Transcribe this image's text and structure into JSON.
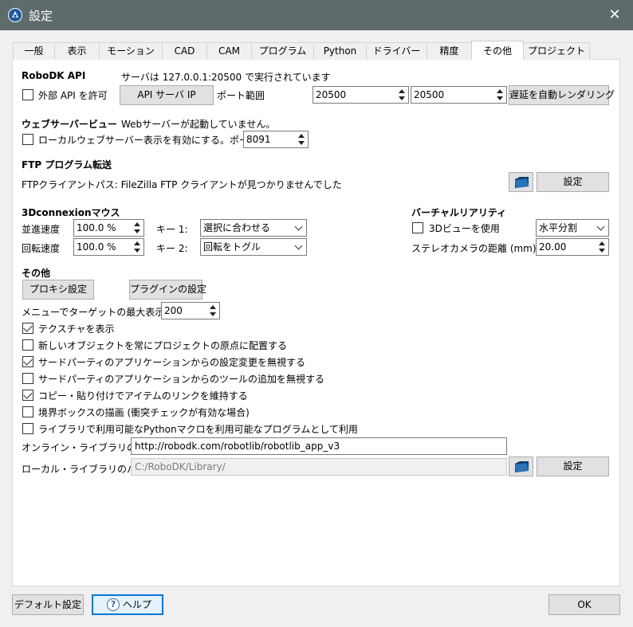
{
  "window": {
    "title": "設定",
    "close_glyph": "✕"
  },
  "tabs": [
    {
      "label": "一般"
    },
    {
      "label": "表示"
    },
    {
      "label": "モーション"
    },
    {
      "label": "CAD"
    },
    {
      "label": "CAM"
    },
    {
      "label": "プログラム"
    },
    {
      "label": "Python"
    },
    {
      "label": "ドライバー"
    },
    {
      "label": "精度"
    },
    {
      "label": "その他",
      "active": true
    },
    {
      "label": "プロジェクト"
    }
  ],
  "robodk_api": {
    "title": "RoboDK API",
    "status": "サーバは 127.0.0.1:20500 で実行されています",
    "allow_external_label": "外部 API を許可",
    "allow_external_checked": false,
    "api_server_ip_button": "API サーバ IP",
    "port_range_label": "ポート範囲",
    "port_from": "20500",
    "port_to": "20500",
    "auto_render_delay_button": "遅延を自動レンダリング"
  },
  "web_server": {
    "title": "ウェブサーバービュー",
    "status": "Webサーバーが起動していません。",
    "enable_label": "ローカルウェブサーバー表示を有効にする。ポート:",
    "enable_checked": false,
    "port": "8091"
  },
  "ftp": {
    "title": "FTP プログラム転送",
    "client_path": "FTPクライアントパス: FileZilla FTP クライアントが見つかりませんでした",
    "settings_button": "設定"
  },
  "connexion": {
    "title": "3Dconnexionマウス",
    "translation_speed_label": "並進速度",
    "translation_speed": "100.0 %",
    "rotation_speed_label": "回転速度",
    "rotation_speed": "100.0 %",
    "key1_label": "キー 1:",
    "key1_value": "選択に合わせる",
    "key2_label": "キー 2:",
    "key2_value": "回転をトグル"
  },
  "vr": {
    "title": "バーチャルリアリティ",
    "use_3d_label": "3Dビューを使用",
    "use_3d_checked": false,
    "split_mode": "水平分割",
    "stereo_distance_label": "ステレオカメラの距離 (mm)",
    "stereo_distance": "20.00"
  },
  "other": {
    "title": "その他",
    "proxy_button": "プロキシ設定",
    "plugin_button": "プラグインの設定",
    "max_targets_label": "メニューでターゲットの最大表示数",
    "max_targets": "200",
    "options": [
      {
        "label": "テクスチャを表示",
        "checked": true
      },
      {
        "label": "新しいオブジェクトを常にプロジェクトの原点に配置する",
        "checked": false
      },
      {
        "label": "サードパーティのアプリケーションからの設定変更を無視する",
        "checked": true
      },
      {
        "label": "サードパーティのアプリケーションからのツールの追加を無視する",
        "checked": false
      },
      {
        "label": "コピー・貼り付けでアイテムのリンクを維持する",
        "checked": true
      },
      {
        "label": "境界ボックスの描画 (衝突チェックが有効な場合)",
        "checked": false
      },
      {
        "label": "ライブラリで利用可能なPythonマクロを利用可能なプログラムとして利用",
        "checked": false
      }
    ],
    "online_library_label": "オンライン・ライブラリのパス:",
    "online_library_path": "http://robodk.com/robotlib/robotlib_app_v3",
    "local_library_label": "ローカル・ライブラリのパス:",
    "local_library_path": "C:/RoboDK/Library/",
    "local_settings_button": "設定"
  },
  "footer": {
    "default_button": "デフォルト設定",
    "help_button": "ヘルプ",
    "help_glyph": "?",
    "ok_button": "OK"
  }
}
